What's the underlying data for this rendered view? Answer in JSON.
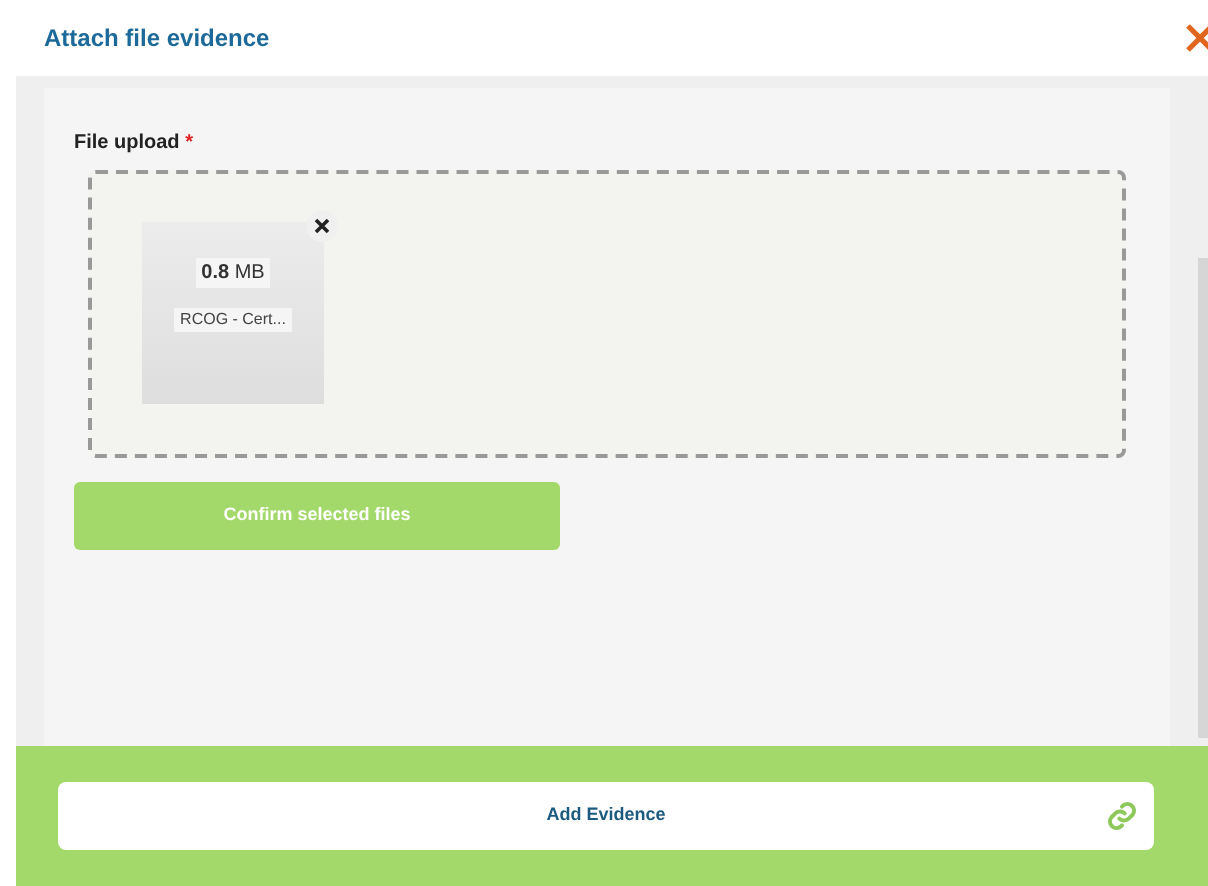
{
  "dialog": {
    "title": "Attach file evidence"
  },
  "file_upload": {
    "label": "File upload",
    "required_mark": "*",
    "files": [
      {
        "size_value": "0.8",
        "size_unit": "MB",
        "name": "RCOG - Cert..."
      }
    ]
  },
  "confirm_button": "Confirm selected files",
  "footer": {
    "button": "Add Evidence"
  }
}
